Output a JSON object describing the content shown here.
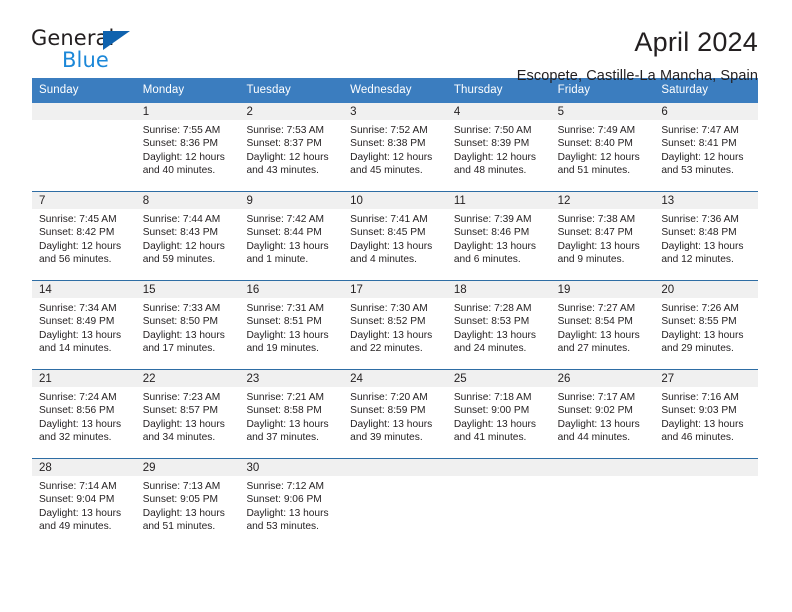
{
  "brand": {
    "name_part1": "General",
    "name_part2": "Blue",
    "logo_icon": "triangle-logo-icon",
    "color_dark": "#231f20",
    "color_blue": "#1b87d8",
    "color_triangle": "#0f62ae"
  },
  "header": {
    "title": "April 2024",
    "subtitle": "Escopete, Castille-La Mancha, Spain"
  },
  "theme": {
    "header_row_bg": "#3b7dbf",
    "row_divider": "#2e6da4",
    "daynum_band_bg": "#f0f0f0",
    "text": "#231f20"
  },
  "calendar": {
    "weekday_headers": [
      "Sunday",
      "Monday",
      "Tuesday",
      "Wednesday",
      "Thursday",
      "Friday",
      "Saturday"
    ],
    "weeks": [
      [
        {
          "day": "",
          "lines": []
        },
        {
          "day": "1",
          "lines": [
            "Sunrise: 7:55 AM",
            "Sunset: 8:36 PM",
            "Daylight: 12 hours",
            "and 40 minutes."
          ]
        },
        {
          "day": "2",
          "lines": [
            "Sunrise: 7:53 AM",
            "Sunset: 8:37 PM",
            "Daylight: 12 hours",
            "and 43 minutes."
          ]
        },
        {
          "day": "3",
          "lines": [
            "Sunrise: 7:52 AM",
            "Sunset: 8:38 PM",
            "Daylight: 12 hours",
            "and 45 minutes."
          ]
        },
        {
          "day": "4",
          "lines": [
            "Sunrise: 7:50 AM",
            "Sunset: 8:39 PM",
            "Daylight: 12 hours",
            "and 48 minutes."
          ]
        },
        {
          "day": "5",
          "lines": [
            "Sunrise: 7:49 AM",
            "Sunset: 8:40 PM",
            "Daylight: 12 hours",
            "and 51 minutes."
          ]
        },
        {
          "day": "6",
          "lines": [
            "Sunrise: 7:47 AM",
            "Sunset: 8:41 PM",
            "Daylight: 12 hours",
            "and 53 minutes."
          ]
        }
      ],
      [
        {
          "day": "7",
          "lines": [
            "Sunrise: 7:45 AM",
            "Sunset: 8:42 PM",
            "Daylight: 12 hours",
            "and 56 minutes."
          ]
        },
        {
          "day": "8",
          "lines": [
            "Sunrise: 7:44 AM",
            "Sunset: 8:43 PM",
            "Daylight: 12 hours",
            "and 59 minutes."
          ]
        },
        {
          "day": "9",
          "lines": [
            "Sunrise: 7:42 AM",
            "Sunset: 8:44 PM",
            "Daylight: 13 hours",
            "and 1 minute."
          ]
        },
        {
          "day": "10",
          "lines": [
            "Sunrise: 7:41 AM",
            "Sunset: 8:45 PM",
            "Daylight: 13 hours",
            "and 4 minutes."
          ]
        },
        {
          "day": "11",
          "lines": [
            "Sunrise: 7:39 AM",
            "Sunset: 8:46 PM",
            "Daylight: 13 hours",
            "and 6 minutes."
          ]
        },
        {
          "day": "12",
          "lines": [
            "Sunrise: 7:38 AM",
            "Sunset: 8:47 PM",
            "Daylight: 13 hours",
            "and 9 minutes."
          ]
        },
        {
          "day": "13",
          "lines": [
            "Sunrise: 7:36 AM",
            "Sunset: 8:48 PM",
            "Daylight: 13 hours",
            "and 12 minutes."
          ]
        }
      ],
      [
        {
          "day": "14",
          "lines": [
            "Sunrise: 7:34 AM",
            "Sunset: 8:49 PM",
            "Daylight: 13 hours",
            "and 14 minutes."
          ]
        },
        {
          "day": "15",
          "lines": [
            "Sunrise: 7:33 AM",
            "Sunset: 8:50 PM",
            "Daylight: 13 hours",
            "and 17 minutes."
          ]
        },
        {
          "day": "16",
          "lines": [
            "Sunrise: 7:31 AM",
            "Sunset: 8:51 PM",
            "Daylight: 13 hours",
            "and 19 minutes."
          ]
        },
        {
          "day": "17",
          "lines": [
            "Sunrise: 7:30 AM",
            "Sunset: 8:52 PM",
            "Daylight: 13 hours",
            "and 22 minutes."
          ]
        },
        {
          "day": "18",
          "lines": [
            "Sunrise: 7:28 AM",
            "Sunset: 8:53 PM",
            "Daylight: 13 hours",
            "and 24 minutes."
          ]
        },
        {
          "day": "19",
          "lines": [
            "Sunrise: 7:27 AM",
            "Sunset: 8:54 PM",
            "Daylight: 13 hours",
            "and 27 minutes."
          ]
        },
        {
          "day": "20",
          "lines": [
            "Sunrise: 7:26 AM",
            "Sunset: 8:55 PM",
            "Daylight: 13 hours",
            "and 29 minutes."
          ]
        }
      ],
      [
        {
          "day": "21",
          "lines": [
            "Sunrise: 7:24 AM",
            "Sunset: 8:56 PM",
            "Daylight: 13 hours",
            "and 32 minutes."
          ]
        },
        {
          "day": "22",
          "lines": [
            "Sunrise: 7:23 AM",
            "Sunset: 8:57 PM",
            "Daylight: 13 hours",
            "and 34 minutes."
          ]
        },
        {
          "day": "23",
          "lines": [
            "Sunrise: 7:21 AM",
            "Sunset: 8:58 PM",
            "Daylight: 13 hours",
            "and 37 minutes."
          ]
        },
        {
          "day": "24",
          "lines": [
            "Sunrise: 7:20 AM",
            "Sunset: 8:59 PM",
            "Daylight: 13 hours",
            "and 39 minutes."
          ]
        },
        {
          "day": "25",
          "lines": [
            "Sunrise: 7:18 AM",
            "Sunset: 9:00 PM",
            "Daylight: 13 hours",
            "and 41 minutes."
          ]
        },
        {
          "day": "26",
          "lines": [
            "Sunrise: 7:17 AM",
            "Sunset: 9:02 PM",
            "Daylight: 13 hours",
            "and 44 minutes."
          ]
        },
        {
          "day": "27",
          "lines": [
            "Sunrise: 7:16 AM",
            "Sunset: 9:03 PM",
            "Daylight: 13 hours",
            "and 46 minutes."
          ]
        }
      ],
      [
        {
          "day": "28",
          "lines": [
            "Sunrise: 7:14 AM",
            "Sunset: 9:04 PM",
            "Daylight: 13 hours",
            "and 49 minutes."
          ]
        },
        {
          "day": "29",
          "lines": [
            "Sunrise: 7:13 AM",
            "Sunset: 9:05 PM",
            "Daylight: 13 hours",
            "and 51 minutes."
          ]
        },
        {
          "day": "30",
          "lines": [
            "Sunrise: 7:12 AM",
            "Sunset: 9:06 PM",
            "Daylight: 13 hours",
            "and 53 minutes."
          ]
        },
        {
          "day": "",
          "lines": []
        },
        {
          "day": "",
          "lines": []
        },
        {
          "day": "",
          "lines": []
        },
        {
          "day": "",
          "lines": []
        }
      ]
    ]
  }
}
